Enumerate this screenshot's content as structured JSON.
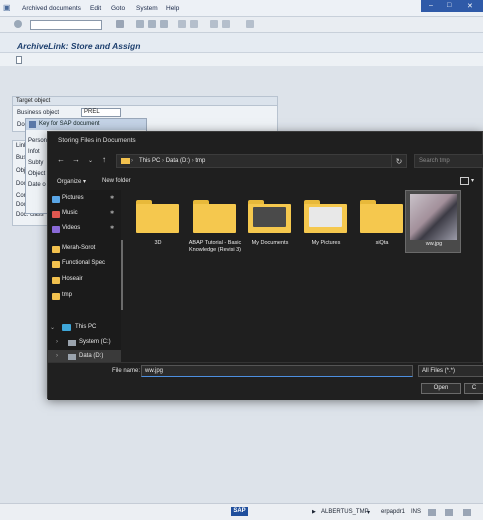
{
  "menu": [
    "Archived documents",
    "Edit",
    "Goto",
    "System",
    "Help"
  ],
  "window_buttons": [
    "–",
    "□",
    "✕"
  ],
  "page_title": "ArchiveLink: Store and Assign",
  "target": {
    "header": "Target object",
    "business_object_label": "Business object",
    "business_object_value": "PREL",
    "doc_label_partial": "Doc"
  },
  "links_partial": [
    "Link",
    "Bus",
    "Obj",
    "Doc",
    "Con",
    "Doc",
    "Doc. class"
  ],
  "key_dialog": {
    "title": "Key for SAP document",
    "rows": [
      "Person",
      "Infot",
      "Subty",
      "Object",
      "Date o"
    ]
  },
  "file_dialog": {
    "title": "Storing Files in Documents",
    "breadcrumb": [
      "This PC",
      "Data (D:)",
      "tmp"
    ],
    "search_placeholder": "Search tmp",
    "organize": "Organize",
    "new_folder": "New folder",
    "quick_access": [
      {
        "label": "Pictures",
        "icon": "pictures-icon",
        "color": "#5aa6e6",
        "pinned": true
      },
      {
        "label": "Music",
        "icon": "music-icon",
        "color": "#e0574f",
        "pinned": true
      },
      {
        "label": "Videos",
        "icon": "videos-icon",
        "color": "#8a6ad8",
        "pinned": true
      },
      {
        "label": "Merah-Sorot",
        "icon": "folder-icon",
        "color": "#f2c14e",
        "pinned": false
      },
      {
        "label": "Functional Spec",
        "icon": "folder-icon",
        "color": "#f2c14e",
        "pinned": false
      },
      {
        "label": "Hoseair",
        "icon": "folder-icon",
        "color": "#f2c14e",
        "pinned": false
      },
      {
        "label": "tmp",
        "icon": "folder-icon",
        "color": "#f2c14e",
        "pinned": false
      }
    ],
    "this_pc": "This PC",
    "drives": [
      "System (C:)",
      "Data (D:)"
    ],
    "files": [
      {
        "name": "3D",
        "type": "folder"
      },
      {
        "name": "ABAP Tutorial - Basic Knowledge (Revisi 3)",
        "type": "folder"
      },
      {
        "name": "My Documents",
        "type": "folder"
      },
      {
        "name": "My Pictures",
        "type": "folder"
      },
      {
        "name": "siQta",
        "type": "folder"
      },
      {
        "name": "ww.jpg",
        "type": "image"
      }
    ],
    "file_name_label": "File name:",
    "file_name_value": "ww.jpg",
    "filter_value": "All Files (*.*)",
    "open_label": "Open",
    "cancel_label": "C"
  },
  "status": {
    "sap": "SAP",
    "user": "ALBERTUS_TMP",
    "server": "erpapdr1",
    "mode": "INS"
  }
}
